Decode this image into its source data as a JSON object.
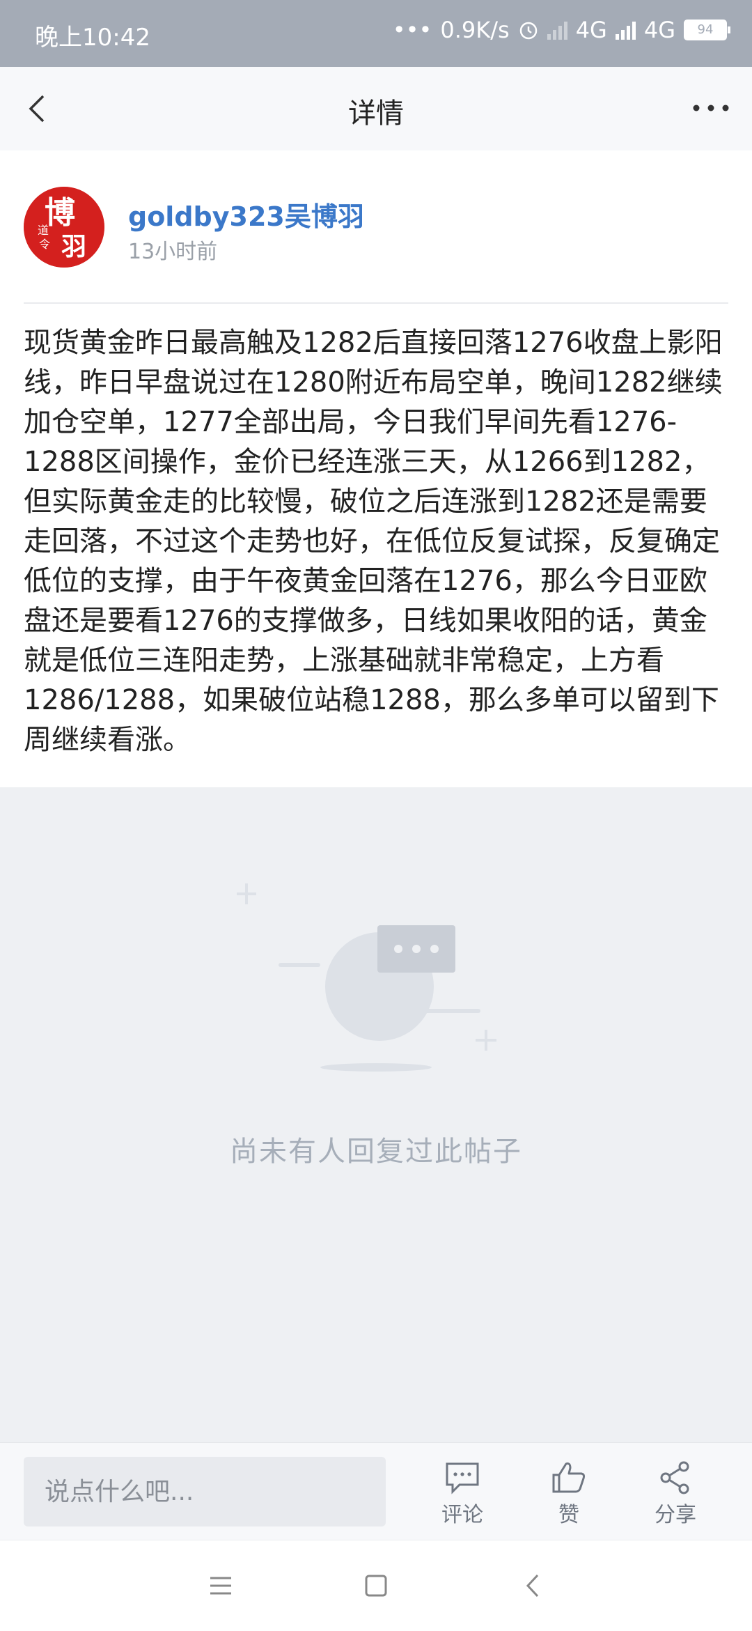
{
  "status_bar": {
    "time": "晚上10:42",
    "net_speed": "0.9K/s",
    "network1": "4G",
    "network2": "4G",
    "battery": "94"
  },
  "header": {
    "title": "详情",
    "back_icon": "chevron-left-icon",
    "more_icon": "more-dots-icon"
  },
  "post": {
    "author": "goldby323吴博羽",
    "time_ago": "13小时前",
    "content": "现货黄金昨日最高触及1282后直接回落1276收盘上影阳线，昨日早盘说过在1280附近布局空单，晚间1282继续加仓空单，1277全部出局，今日我们早间先看1276-1288区间操作，金价已经连涨三天，从1266到1282，但实际黄金走的比较慢，破位之后连涨到1282还是需要走回落，不过这个走势也好，在低位反复试探，反复确定低位的支撑，由于午夜黄金回落在1276，那么今日亚欧盘还是要看1276的支撑做多，日线如果收阳的话，黄金就是低位三连阳走势，上涨基础就非常稳定，上方看1286/1288，如果破位站稳1288，那么多单可以留到下周继续看涨。"
  },
  "empty_state": {
    "text": "尚未有人回复过此帖子"
  },
  "bottom_bar": {
    "input_placeholder": "说点什么吧...",
    "comment_label": "评论",
    "like_label": "赞",
    "share_label": "分享"
  },
  "colors": {
    "status_bar_bg": "#a4abb6",
    "username": "#3b78c9",
    "avatar_bg": "#d4201e",
    "empty_bg": "#eef0f3"
  }
}
